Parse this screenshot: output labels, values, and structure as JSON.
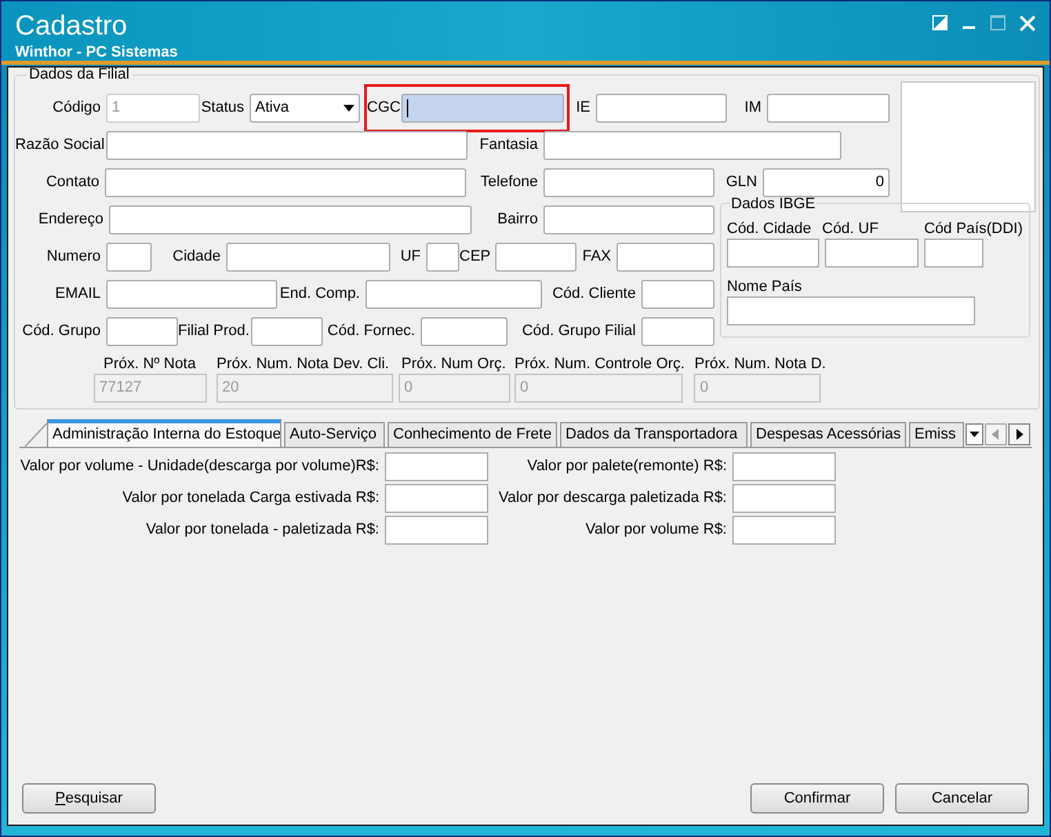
{
  "window": {
    "title": "Cadastro",
    "subtitle": "Winthor - PC Sistemas"
  },
  "filial": {
    "title": "Dados da Filial",
    "top_rows": [
      [
        {
          "label": "Código",
          "kind": "input",
          "value": "1",
          "disabled": true,
          "highlighted": false
        },
        {
          "label": "Status",
          "kind": "select",
          "value": "Ativa",
          "disabled": false,
          "highlighted": false
        },
        {
          "label": "CGC",
          "kind": "input",
          "focused": true,
          "disabled": false,
          "highlighted": true
        },
        {
          "label": "IE",
          "kind": "input",
          "disabled": false,
          "highlighted": false
        },
        {
          "label": "IM",
          "kind": "input",
          "disabled": false,
          "highlighted": false
        }
      ],
      [
        {
          "label": "Razão Social",
          "kind": "input",
          "disabled": false,
          "highlighted": false
        },
        {
          "label": "Fantasia",
          "kind": "input",
          "disabled": false,
          "highlighted": false
        }
      ],
      [
        {
          "label": "Contato",
          "kind": "input",
          "disabled": false,
          "highlighted": false
        },
        {
          "label": "Telefone",
          "kind": "input",
          "disabled": false,
          "highlighted": false
        },
        {
          "label": "GLN",
          "kind": "input",
          "value": "0",
          "disabled": false,
          "highlighted": false
        }
      ]
    ],
    "bottom_rows": [
      [
        {
          "label": "Endereço",
          "kind": "input",
          "disabled": false,
          "highlighted": false
        },
        {
          "label": "Bairro",
          "kind": "input",
          "disabled": false,
          "highlighted": false
        }
      ],
      [
        {
          "label": "Numero",
          "kind": "input",
          "disabled": false,
          "highlighted": false
        },
        {
          "label": "Cidade",
          "kind": "input",
          "disabled": false,
          "highlighted": false
        },
        {
          "label": "UF",
          "kind": "input",
          "disabled": false,
          "highlighted": false
        },
        {
          "label": "CEP",
          "kind": "input",
          "disabled": false,
          "highlighted": false
        },
        {
          "label": "FAX",
          "kind": "input",
          "disabled": false,
          "highlighted": false
        }
      ],
      [
        {
          "label": "EMAIL",
          "kind": "input",
          "disabled": false,
          "highlighted": false
        },
        {
          "label": "End. Comp.",
          "kind": "input",
          "disabled": false,
          "highlighted": false
        },
        {
          "label": "Cód. Cliente",
          "kind": "input",
          "disabled": false,
          "highlighted": false
        }
      ],
      [
        {
          "label": "Cód. Grupo",
          "kind": "input",
          "disabled": false,
          "highlighted": false
        },
        {
          "label": "Filial Prod.",
          "kind": "input",
          "disabled": false,
          "highlighted": false
        },
        {
          "label": "Cód. Fornec.",
          "kind": "input",
          "disabled": false,
          "highlighted": false
        },
        {
          "label": "Cód. Grupo Filial",
          "kind": "input",
          "disabled": false,
          "highlighted": false
        }
      ]
    ],
    "ibge": {
      "title": "Dados IBGE",
      "fields": [
        {
          "label": "Cód. Cidade"
        },
        {
          "label": "Cód. UF"
        },
        {
          "label": "Cód País(DDI)"
        }
      ],
      "country": {
        "label": "Nome País"
      }
    },
    "next_numbers": [
      {
        "label": "Próx. Nº Nota",
        "value": "77127"
      },
      {
        "label": "Próx. Num. Nota Dev. Cli.",
        "value": "20"
      },
      {
        "label": "Próx. Num Orç.",
        "value": "0"
      },
      {
        "label": "Próx. Num. Controle Orç.",
        "value": "0"
      },
      {
        "label": "Próx. Num. Nota D.",
        "value": "0"
      }
    ]
  },
  "tabs": [
    {
      "label": "Administração Interna do Estoque",
      "selected": true
    },
    {
      "label": "Auto-Serviço",
      "selected": false
    },
    {
      "label": "Conhecimento de Frete",
      "selected": false
    },
    {
      "label": "Dados da Transportadora",
      "selected": false
    },
    {
      "label": "Despesas Acessórias",
      "selected": false
    },
    {
      "label": "Emiss",
      "selected": false
    }
  ],
  "tab_scroll": {
    "back_disabled": true,
    "forward_disabled": false
  },
  "tab_panel": {
    "left": [
      {
        "label": "Valor por volume - Unidade(descarga por volume)R$:"
      },
      {
        "label": "Valor por tonelada Carga estivada R$:"
      },
      {
        "label": "Valor por tonelada - paletizada R$:"
      }
    ],
    "right": [
      {
        "label": "Valor por palete(remonte) R$:"
      },
      {
        "label": "Valor por descarga paletizada R$:"
      },
      {
        "label": "Valor por volume R$:"
      }
    ]
  },
  "buttons": [
    {
      "label": "Pesquisar",
      "underline_first": true
    },
    {
      "label": "Confirmar",
      "underline_first": false
    },
    {
      "label": "Cancelar",
      "underline_first": false
    }
  ]
}
